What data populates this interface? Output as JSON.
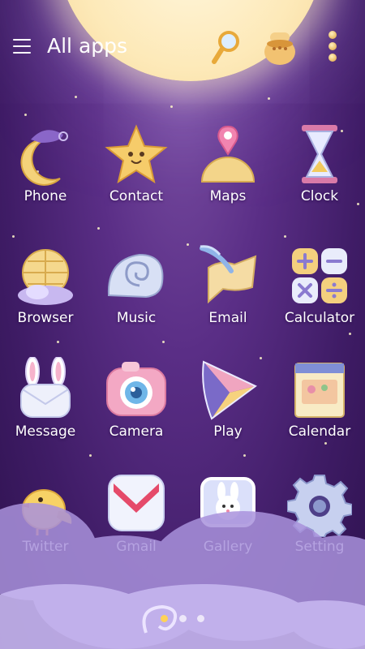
{
  "header": {
    "title": "All apps",
    "menu_icon": "menu-icon",
    "search_icon": "magnifier-icon",
    "theme_icon": "honey-pot-icon",
    "more_icon": "more-vertical-icon"
  },
  "apps": [
    {
      "label": "Phone",
      "icon": "moon-phone-icon"
    },
    {
      "label": "Contact",
      "icon": "star-contact-icon"
    },
    {
      "label": "Maps",
      "icon": "maps-pin-icon"
    },
    {
      "label": "Clock",
      "icon": "hourglass-clock-icon"
    },
    {
      "label": "Browser",
      "icon": "globe-browser-icon"
    },
    {
      "label": "Music",
      "icon": "shell-music-icon"
    },
    {
      "label": "Email",
      "icon": "scroll-email-icon"
    },
    {
      "label": "Calculator",
      "icon": "calculator-icon"
    },
    {
      "label": "Message",
      "icon": "bunny-message-icon"
    },
    {
      "label": "Camera",
      "icon": "camera-icon"
    },
    {
      "label": "Play",
      "icon": "play-store-icon"
    },
    {
      "label": "Calendar",
      "icon": "calendar-icon"
    },
    {
      "label": "Twitter",
      "icon": "chick-twitter-icon"
    },
    {
      "label": "Gmail",
      "icon": "gmail-icon"
    },
    {
      "label": "Gallery",
      "icon": "bunny-gallery-icon"
    },
    {
      "label": "Setting",
      "icon": "gear-setting-icon"
    }
  ],
  "page_indicator": {
    "pages": 3,
    "current": 1
  },
  "colors": {
    "background": "#4a2478",
    "moon": "#fde9b8",
    "accent": "#ffd257"
  }
}
